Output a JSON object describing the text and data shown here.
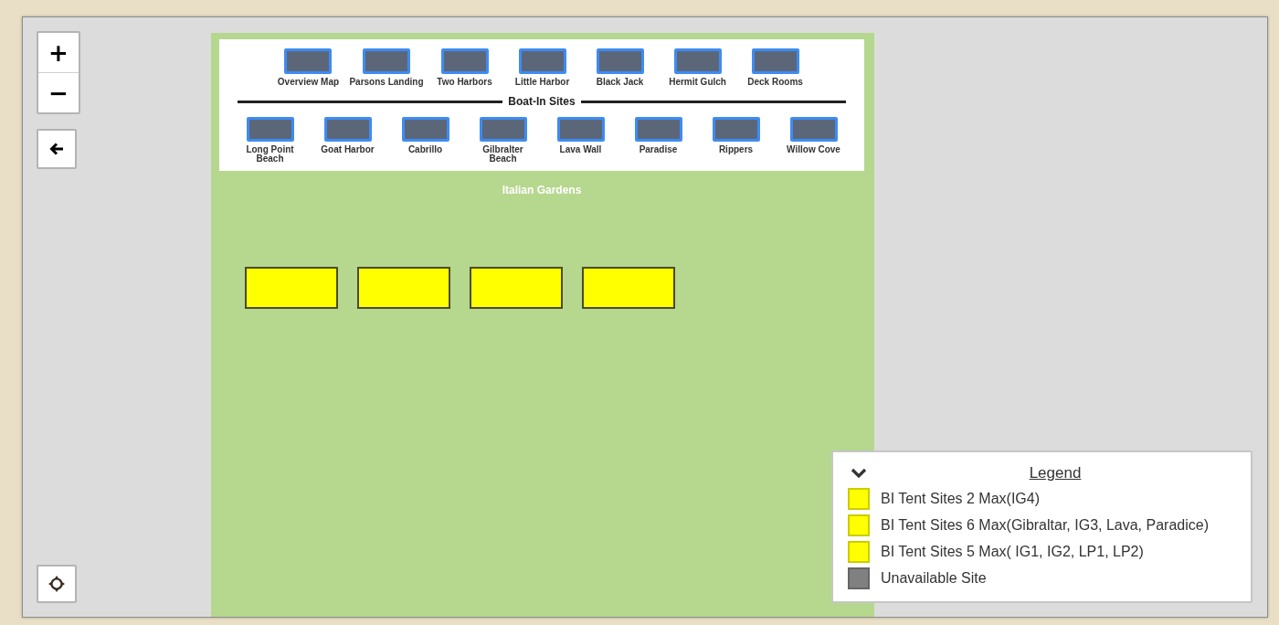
{
  "map_controls": {
    "zoom_in": "+",
    "zoom_out": "−"
  },
  "navigation": {
    "locations": [
      "Overview Map",
      "Parsons Landing",
      "Two Harbors",
      "Little Harbor",
      "Black Jack",
      "Hermit Gulch",
      "Deck Rooms"
    ],
    "section_title": "Boat-In Sites",
    "boat_in_sites": [
      "Long Point Beach",
      "Goat Harbor",
      "Cabrillo",
      "Gilbralter Beach",
      "Lava Wall",
      "Paradise",
      "Rippers",
      "Willow Cove"
    ]
  },
  "area_title": "Italian Gardens",
  "sites": [
    {
      "color": "#ffff00"
    },
    {
      "color": "#ffff00"
    },
    {
      "color": "#ffff00"
    },
    {
      "color": "#ffff00"
    }
  ],
  "legend": {
    "title": "Legend",
    "expanded": true,
    "items": [
      {
        "label": "BI Tent Sites 2 Max(IG4)",
        "color": "#ffff00"
      },
      {
        "label": "BI Tent Sites 6 Max(Gibraltar, IG3, Lava, Paradice)",
        "color": "#ffff00"
      },
      {
        "label": "BI Tent Sites 5 Max( IG1, IG2, LP1, LP2)",
        "color": "#ffff00"
      },
      {
        "label": "Unavailable Site",
        "color": "#808080"
      }
    ]
  }
}
